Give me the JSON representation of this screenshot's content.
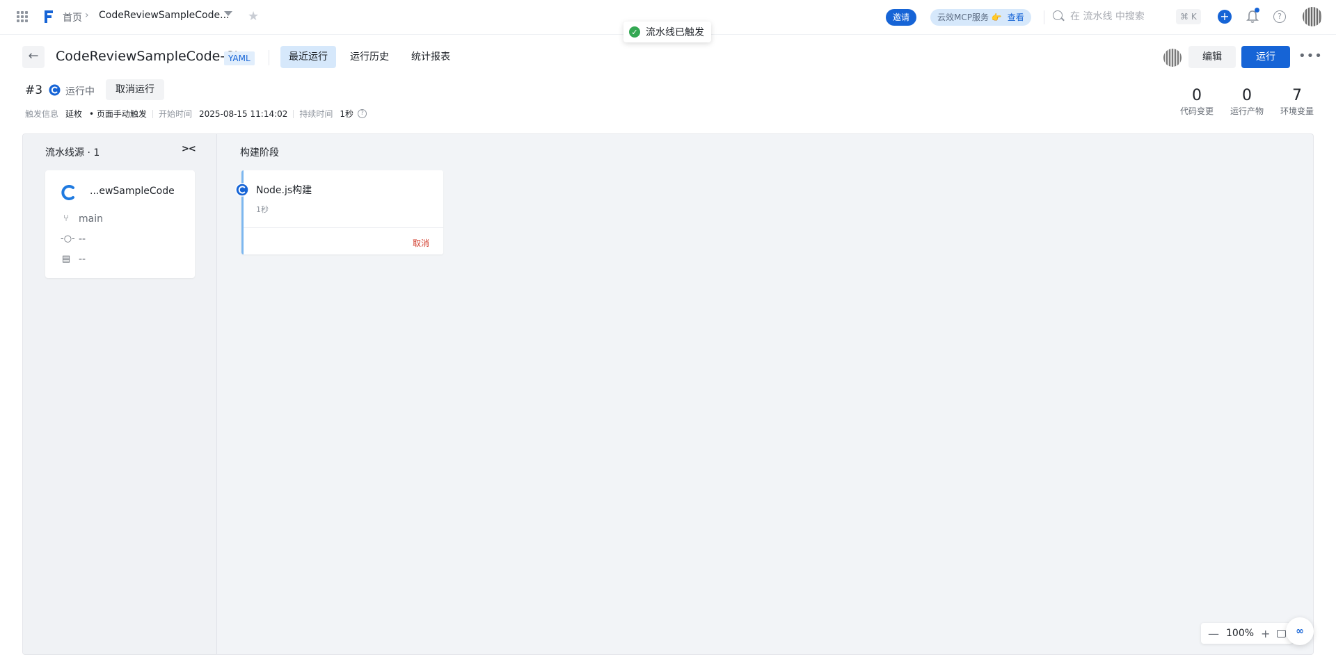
{
  "nav": {
    "home": "首页",
    "project": "CodeReviewSampleCode...",
    "invite": "邀请",
    "mcp_text": "云效MCP服务 👉",
    "mcp_view": "查看",
    "search_placeholder": "在 流水线 中搜索",
    "shortcut": "⌘ K"
  },
  "toast": {
    "message": "流水线已触发"
  },
  "header": {
    "title": "CodeReviewSampleCode-CI",
    "tag": "YAML",
    "tabs": [
      {
        "label": "最近运行",
        "active": true
      },
      {
        "label": "运行历史",
        "active": false
      },
      {
        "label": "统计报表",
        "active": false
      }
    ],
    "edit_label": "编辑",
    "run_label": "运行"
  },
  "run": {
    "number": "#3",
    "status": "运行中",
    "cancel_label": "取消运行",
    "trigger_label": "触发信息",
    "trigger_user": "延枚",
    "trigger_type": "• 页面手动触发",
    "start_label": "开始时间",
    "start_time": "2025-08-15 11:14:02",
    "duration_label": "持续时间",
    "duration": "1秒"
  },
  "stats": [
    {
      "value": "0",
      "label": "代码变更"
    },
    {
      "value": "0",
      "label": "运行产物"
    },
    {
      "value": "7",
      "label": "环境变量"
    }
  ],
  "sources": {
    "title": "流水线源 · 1",
    "repo": "...ewSampleCode",
    "branch": "main",
    "commit": "--",
    "message": "--"
  },
  "stage": {
    "title": "构建阶段",
    "job_name": "Node.js构建",
    "job_duration": "1秒",
    "job_cancel": "取消"
  },
  "zoom": {
    "level": "100%"
  },
  "colors": {
    "accent": "#1664d6",
    "danger": "#d13b2b",
    "success": "#34a853"
  }
}
